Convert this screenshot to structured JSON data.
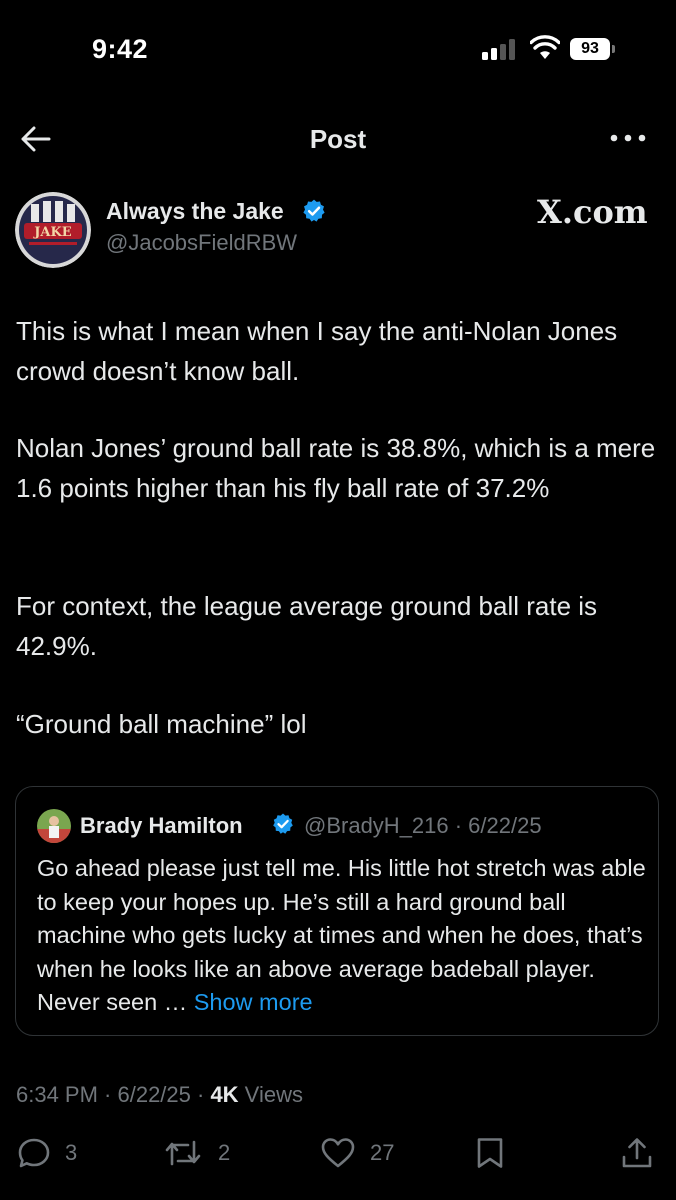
{
  "status_bar": {
    "time": "9:42",
    "battery": "93"
  },
  "nav": {
    "title": "Post"
  },
  "author": {
    "name": "Always the Jake",
    "handle": "@JacobsFieldRBW",
    "badge_text": "X.com"
  },
  "post": {
    "paragraphs": [
      "This is what I mean when I say the anti-Nolan Jones crowd doesn’t know ball.",
      "Nolan Jones’ ground ball rate is 38.8%, which is a mere 1.6 points higher than his fly ball rate of 37.2%",
      "For context, the league average ground ball rate is 42.9%.",
      "“Ground ball machine” lol"
    ]
  },
  "quote": {
    "name": "Brady Hamilton",
    "handle_date": "@BradyH_216 · 6/22/25",
    "text": "Go ahead please just tell me. His little hot stretch was able to keep your hopes up. He’s still a hard ground ball machine who gets lucky at times and when he does, that’s when he looks like an above average badeball player. Never seen … ",
    "show_more": "Show more"
  },
  "meta": {
    "time_date": "6:34 PM · 6/22/25 · ",
    "views_count": "4K",
    "views_label": " Views"
  },
  "actions": {
    "replies": "3",
    "reposts": "2",
    "likes": "27"
  },
  "colors": {
    "background": "#000000",
    "text": "#e7e9ea",
    "secondary": "#71767b",
    "accent": "#1d9bf0",
    "border": "#2f3336"
  }
}
